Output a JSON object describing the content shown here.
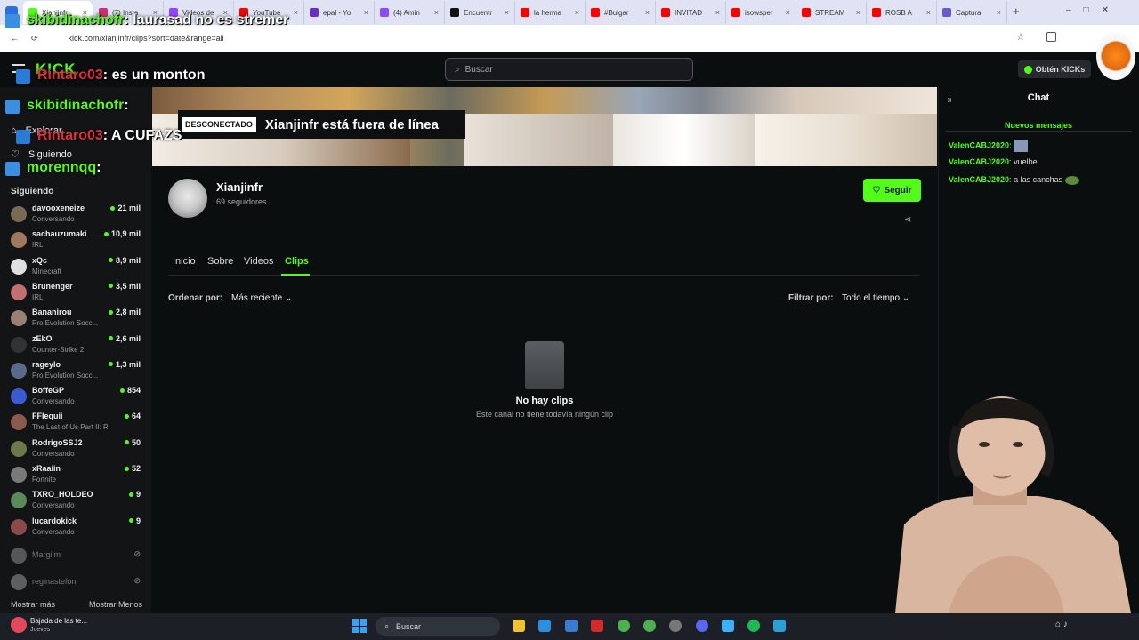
{
  "browser": {
    "tabs": [
      {
        "label": "Xianjinfr",
        "color": "#53fc18",
        "active": true
      },
      {
        "label": "(7) Insta",
        "color": "#d62976"
      },
      {
        "label": "Videos de",
        "color": "#9146ff"
      },
      {
        "label": "YouTube",
        "color": "#ff0000"
      },
      {
        "label": "epal - Yo",
        "color": "#6a2fc2"
      },
      {
        "label": "(4) Amin",
        "color": "#9146ff"
      },
      {
        "label": "Encuentr",
        "color": "#111111"
      },
      {
        "label": "la herma",
        "color": "#ff0000"
      },
      {
        "label": "#Bulgar",
        "color": "#ff0000"
      },
      {
        "label": "INVITAD",
        "color": "#ff0000"
      },
      {
        "label": "isowsper",
        "color": "#ff0000"
      },
      {
        "label": "STREAM",
        "color": "#ff0000"
      },
      {
        "label": "ROSB A",
        "color": "#ff0000"
      },
      {
        "label": "Captura",
        "color": "#6a5acd"
      }
    ],
    "url": "kick.com/xianjinfr/clips?sort=date&range=all"
  },
  "header": {
    "search_placeholder": "Buscar",
    "kicks_label": "Obtén KICKs"
  },
  "sidebar": {
    "explore": "Explorar",
    "following_nav": "Siguiendo",
    "following_section": "Siguiendo",
    "streamers": [
      {
        "name": "davooxeneize",
        "category": "Conversando",
        "viewers": "21 mil",
        "color": "#7a6a55"
      },
      {
        "name": "sachauzumaki",
        "category": "IRL",
        "viewers": "10,9 mil",
        "color": "#a07860"
      },
      {
        "name": "xQc",
        "category": "Minecraft",
        "viewers": "8,9 mil",
        "color": "#e0e0e0"
      },
      {
        "name": "Brunenger",
        "category": "IRL",
        "viewers": "3,5 mil",
        "color": "#c07070"
      },
      {
        "name": "Bananirou",
        "category": "Pro Evolution Socc...",
        "viewers": "2,8 mil",
        "color": "#9a8070"
      },
      {
        "name": "zEkO",
        "category": "Counter-Strike 2",
        "viewers": "2,6 mil",
        "color": "#333333"
      },
      {
        "name": "rageylo",
        "category": "Pro Evolution Socc...",
        "viewers": "1,3 mil",
        "color": "#5a6a8a"
      },
      {
        "name": "BoffeGP",
        "category": "Conversando",
        "viewers": "854",
        "color": "#3a5ad0"
      },
      {
        "name": "FFlequii",
        "category": "The Last of Us Part II: R...",
        "viewers": "64",
        "color": "#8a5a4a"
      },
      {
        "name": "RodrigoSSJ2",
        "category": "Conversando",
        "viewers": "50",
        "color": "#6a7a4a"
      },
      {
        "name": "xRaaiin",
        "category": "Fortnite",
        "viewers": "52",
        "color": "#7a7a7a"
      },
      {
        "name": "TXRO_HOLDEO",
        "category": "Conversando",
        "viewers": "9",
        "color": "#5a8a5a"
      },
      {
        "name": "lucardokick",
        "category": "Conversando",
        "viewers": "9",
        "color": "#8a4a4a"
      }
    ],
    "offline": [
      {
        "name": "Margiim",
        "color": "#999999"
      },
      {
        "name": "reginastefoni",
        "color": "#aaaaaa"
      }
    ],
    "show_more": "Mostrar más",
    "show_less": "Mostrar Menos"
  },
  "channel": {
    "offline_badge": "DESCONECTADO",
    "offline_text": "Xianjinfr está fuera de línea",
    "name": "Xianjinfr",
    "followers": "69 seguidores",
    "follow_label": "Seguir",
    "tabs": [
      "Inicio",
      "Sobre",
      "Videos",
      "Clips"
    ],
    "active_tab": "Clips",
    "sort_label": "Ordenar por:",
    "sort_value": "Más reciente",
    "filter_label": "Filtrar por:",
    "filter_value": "Todo el tiempo",
    "empty_title": "No hay clips",
    "empty_desc": "Este canal no tiene todavía ningún clip"
  },
  "chat": {
    "title": "Chat",
    "new_messages": "Nuevos mensajes",
    "messages": [
      {
        "user": "ValenCABJ2020",
        "text": ""
      },
      {
        "user": "ValenCABJ2020",
        "text": "vuelbe"
      },
      {
        "user": "ValenCABJ2020",
        "text": "a las canchas"
      }
    ]
  },
  "overlay": {
    "lines": [
      {
        "user": "skibidinachofr",
        "sep": ":",
        "text": "laurasad no es stremer",
        "color": "#53fc18"
      },
      {
        "user": "Rintaro03",
        "sep": ":",
        "text": "es un monton",
        "color": "#e0303a"
      },
      {
        "user": "skibidinachofr",
        "sep": ":",
        "text": "",
        "color": "#53fc18"
      },
      {
        "user": "Rintaro03",
        "sep": ":",
        "text": "A CUFAZS",
        "color": "#e0303a"
      },
      {
        "user": "morennqq",
        "sep": ":",
        "text": "",
        "color": "#53fc18"
      }
    ]
  },
  "taskbar": {
    "weather_title": "Bajada de las te...",
    "weather_sub": "Jueves",
    "search": "Buscar"
  },
  "colors": {
    "accent": "#53fc18",
    "bg": "#0b0e0f",
    "sidebar": "#121416"
  }
}
